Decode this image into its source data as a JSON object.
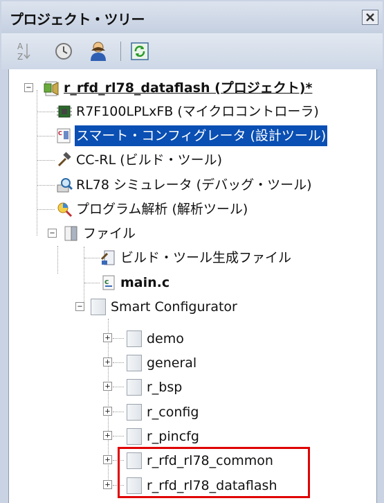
{
  "panel": {
    "title": "プロジェクト・ツリー"
  },
  "tree": {
    "project": "r_rfd_rl78_dataflash (プロジェクト)*",
    "items": [
      {
        "label": "R7F100LPLxFB (マイクロコントローラ)",
        "icon": "microcontroller-icon"
      },
      {
        "label": "スマート・コンフィグレータ (設計ツール)",
        "icon": "smart-configurator-icon",
        "selected": true
      },
      {
        "label": "CC-RL (ビルド・ツール)",
        "icon": "hammer-icon"
      },
      {
        "label": "RL78 シミュレータ (デバッグ・ツール)",
        "icon": "debug-icon"
      },
      {
        "label": "プログラム解析 (解析ツール)",
        "icon": "analysis-icon"
      }
    ],
    "file_folder": "ファイル",
    "file_items": [
      {
        "label": "ビルド・ツール生成ファイル",
        "icon": "build-files-icon"
      },
      {
        "label": "main.c",
        "icon": "c-file-icon",
        "bold": true
      }
    ],
    "smart_configurator": "Smart Configurator",
    "sc_folders": [
      "demo",
      "general",
      "r_bsp",
      "r_config",
      "r_pincfg",
      "r_rfd_rl78_common",
      "r_rfd_rl78_dataflash"
    ]
  },
  "colors": {
    "selection": "#0a4fb3",
    "highlight": "#e00000",
    "panel_bg": "#c9d3e3"
  }
}
